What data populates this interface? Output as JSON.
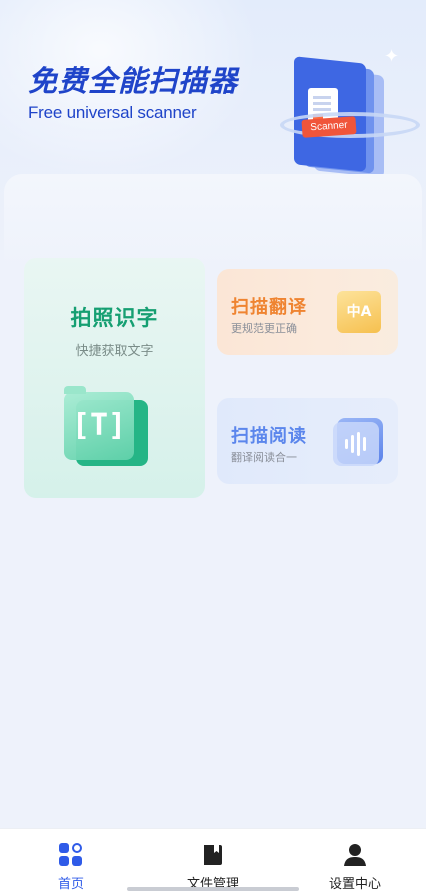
{
  "banner": {
    "title": "免费全能扫描器",
    "subtitle": "Free universal scanner",
    "illustration_tag": "Scanner",
    "sparkle_icon": "sparkle-icon"
  },
  "features": {
    "ocr": {
      "title": "拍照识字",
      "subtitle": "快捷获取文字",
      "icon": "text-scan-icon",
      "icon_glyph": "[T]",
      "color": "#169f72"
    },
    "translate": {
      "title": "扫描翻译",
      "subtitle": "更规范更正确",
      "icon": "translate-icon",
      "icon_glyph": "中A",
      "color": "#ef8431"
    },
    "read": {
      "title": "扫描阅读",
      "subtitle": "翻译阅读合一",
      "icon": "audio-wave-icon",
      "color": "#5b86ec"
    }
  },
  "tabbar": {
    "items": [
      {
        "label": "首页",
        "icon": "home-grid-icon",
        "active": true
      },
      {
        "label": "文件管理",
        "icon": "book-icon",
        "active": false
      },
      {
        "label": "设置中心",
        "icon": "user-icon",
        "active": false
      }
    ],
    "accent": "#2f5be8"
  }
}
